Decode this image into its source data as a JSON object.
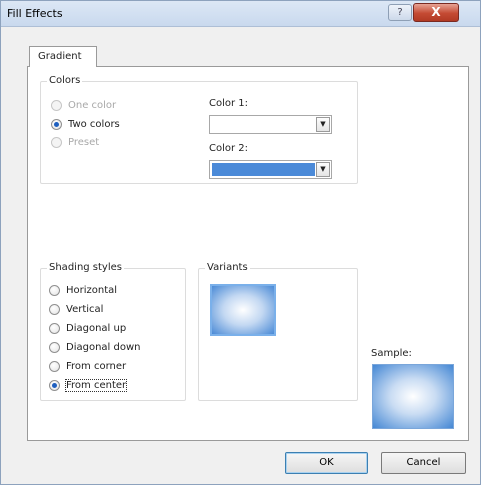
{
  "window": {
    "title": "Fill Effects",
    "help_glyph": "?",
    "close_glyph": "X"
  },
  "tabs": [
    "Gradient"
  ],
  "colors_group": {
    "label": "Colors",
    "options": [
      {
        "label": "One color",
        "checked": false,
        "enabled": false
      },
      {
        "label": "Two colors",
        "checked": true,
        "enabled": true
      },
      {
        "label": "Preset",
        "checked": false,
        "enabled": false
      }
    ],
    "color1_label": "Color 1:",
    "color1_value": "#ffffff",
    "color2_label": "Color 2:",
    "color2_value": "#4b8ad8",
    "dropdown_glyph": "▼"
  },
  "shading_group": {
    "label": "Shading styles",
    "options": [
      {
        "label": "Horizontal",
        "checked": false
      },
      {
        "label": "Vertical",
        "checked": false
      },
      {
        "label": "Diagonal up",
        "checked": false
      },
      {
        "label": "Diagonal down",
        "checked": false
      },
      {
        "label": "From corner",
        "checked": false
      },
      {
        "label": "From center",
        "checked": true
      }
    ]
  },
  "variants_group": {
    "label": "Variants"
  },
  "sample": {
    "label": "Sample:"
  },
  "buttons": {
    "ok": "OK",
    "cancel": "Cancel"
  },
  "colors": {
    "accent": "#4b8ad8",
    "title_bar": "#cfdcef",
    "close": "#c44a33"
  }
}
